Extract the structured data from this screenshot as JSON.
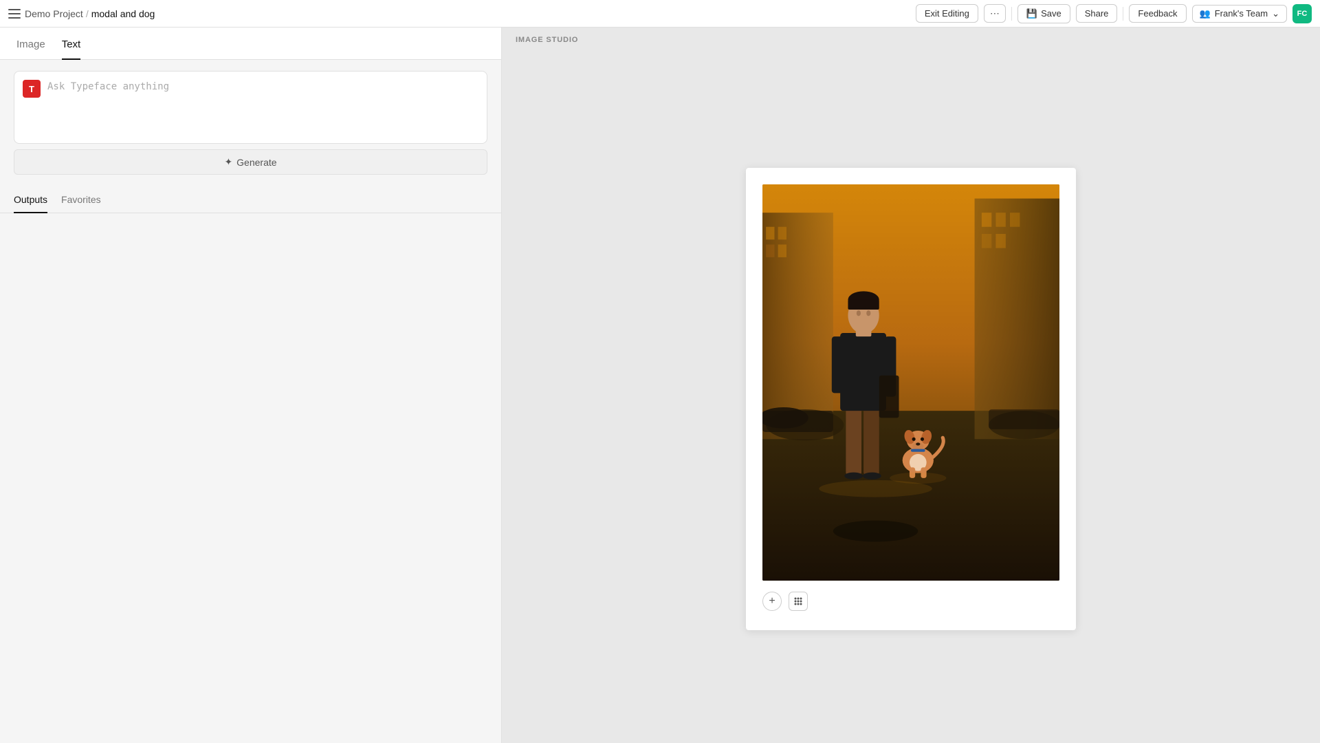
{
  "nav": {
    "hamburger_label": "menu",
    "breadcrumb": {
      "project": "Demo Project",
      "separator": "/",
      "current": "modal and dog"
    },
    "buttons": {
      "exit_editing": "Exit Editing",
      "more": "⋯",
      "save": "Save",
      "share": "Share",
      "feedback": "Feedback",
      "team": "Frank's Team",
      "avatar": "FC"
    }
  },
  "left_panel": {
    "tabs": [
      {
        "id": "image",
        "label": "Image",
        "active": false
      },
      {
        "id": "text",
        "label": "Text",
        "active": true
      }
    ],
    "input": {
      "placeholder": "Ask Typeface anything",
      "typeface_icon": "T",
      "generate_label": "✦ Generate"
    },
    "output_tabs": [
      {
        "id": "outputs",
        "label": "Outputs",
        "active": true
      },
      {
        "id": "favorites",
        "label": "Favorites",
        "active": false
      }
    ]
  },
  "right_panel": {
    "studio_label": "IMAGE STUDIO",
    "image_alt": "Man standing on city street with small dog at golden hour",
    "add_btn": "+",
    "grid_btn": "⋮⋮"
  }
}
